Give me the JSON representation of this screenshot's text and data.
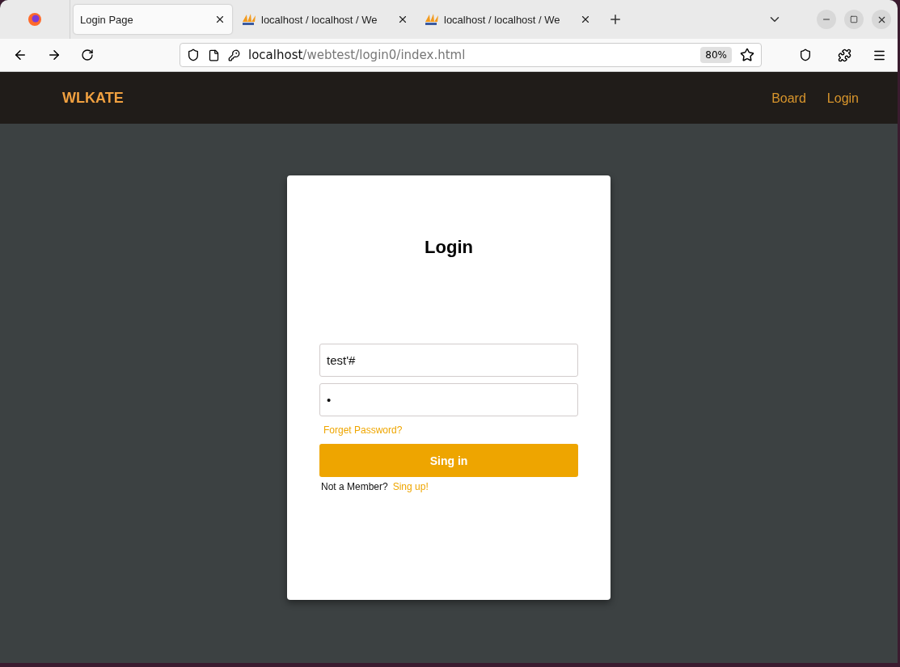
{
  "browser": {
    "tabs": [
      {
        "title": "Login Page",
        "selected": true
      },
      {
        "title": "localhost / localhost / We",
        "selected": false
      },
      {
        "title": "localhost / localhost / We",
        "selected": false
      }
    ],
    "url_host": "localhost",
    "url_path": "/webtest/login0/index.html",
    "zoom": "80%"
  },
  "navbar": {
    "brand": "WLKATE",
    "links": [
      "Board",
      "Login"
    ]
  },
  "login": {
    "title": "Login",
    "username": "test'#",
    "password": "•",
    "forgot": "Forget Password?",
    "submit": "Sing in",
    "signup_prompt": "Not a Member?",
    "signup_link": "Sing up!"
  }
}
